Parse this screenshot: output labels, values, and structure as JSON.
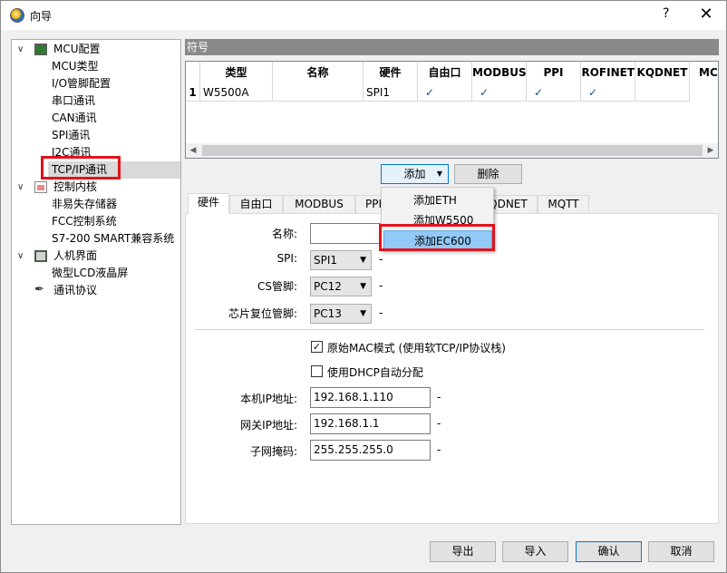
{
  "window": {
    "title": "向导",
    "help": "?",
    "close": "✕"
  },
  "tree": {
    "groups": [
      {
        "label": "MCU配置",
        "children": [
          "MCU类型",
          "I/O管脚配置",
          "串口通讯",
          "CAN通讯",
          "SPI通讯",
          "I2C通讯",
          "TCP/IP通讯"
        ]
      },
      {
        "label": "控制内核",
        "children": [
          "非易失存储器",
          "FCC控制系统",
          "S7-200 SMART兼容系统"
        ]
      },
      {
        "label": "人机界面",
        "children": [
          "微型LCD液晶屏"
        ]
      }
    ],
    "extra": "通讯协议",
    "selected": "TCP/IP通讯"
  },
  "symbols": {
    "header": "符号",
    "columns": [
      "类型",
      "名称",
      "硬件",
      "自由口",
      "MODBUS",
      "PPI",
      "PROFINET",
      "KQDNET",
      "MC"
    ],
    "rows": [
      {
        "index": "1",
        "type": "W5500A",
        "name": "",
        "hardware": "SPI1",
        "checks": [
          "✓",
          "✓",
          "✓",
          "✓"
        ]
      }
    ]
  },
  "actions": {
    "add": "添加",
    "delete": "删除"
  },
  "add_menu": [
    "添加ETH",
    "添加W5500",
    "添加EC600"
  ],
  "tabs": [
    "硬件",
    "自由口",
    "MODBUS",
    "PPI",
    "KQDNET",
    "MQTT"
  ],
  "form": {
    "name_label": "名称:",
    "name_value": "",
    "spi_label": "SPI:",
    "spi_value": "SPI1",
    "cs_label": "CS管脚:",
    "cs_value": "PC12",
    "reset_label": "芯片复位管脚:",
    "reset_value": "PC13",
    "dash": "-",
    "mac_mode_label": "原始MAC模式 (使用软TCP/IP协议栈)",
    "mac_mode_checked": true,
    "dhcp_label": "使用DHCP自动分配",
    "dhcp_checked": false,
    "ip_label": "本机IP地址:",
    "ip_value": "192.168.1.110",
    "gateway_label": "网关IP地址:",
    "gateway_value": "192.168.1.1",
    "mask_label": "子网掩码:",
    "mask_value": "255.255.255.0"
  },
  "footer": {
    "export": "导出",
    "import": "导入",
    "ok": "确认",
    "cancel": "取消"
  },
  "colors": {
    "highlight": "#e0131b",
    "selection": "#91c9f7",
    "accent": "#0078d7"
  }
}
